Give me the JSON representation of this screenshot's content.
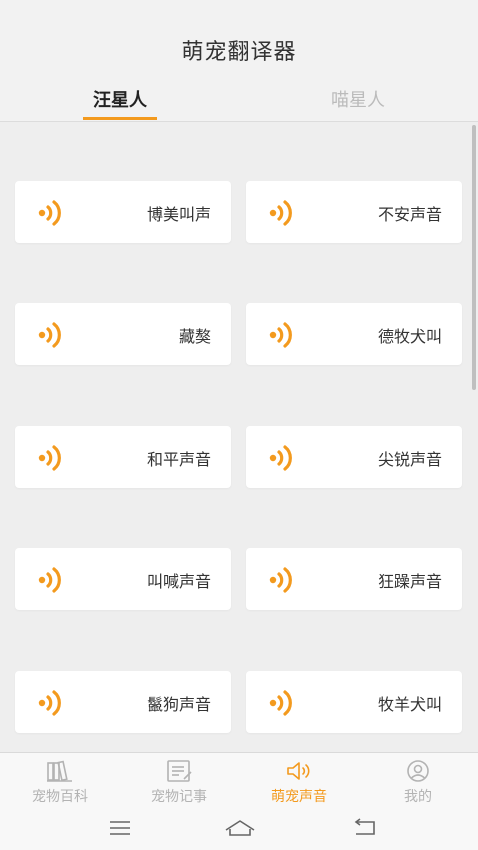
{
  "app": {
    "title": "萌宠翻译器"
  },
  "tabs": [
    {
      "label": "汪星人",
      "active": true
    },
    {
      "label": "喵星人",
      "active": false
    }
  ],
  "sounds": [
    {
      "label": "博美叫声"
    },
    {
      "label": "不安声音"
    },
    {
      "label": "藏獒"
    },
    {
      "label": "德牧犬叫"
    },
    {
      "label": "和平声音"
    },
    {
      "label": "尖锐声音"
    },
    {
      "label": "叫喊声音"
    },
    {
      "label": "狂躁声音"
    },
    {
      "label": "鬣狗声音"
    },
    {
      "label": "牧羊犬叫"
    }
  ],
  "bottom_nav": [
    {
      "label": "宠物百科",
      "icon": "books-icon",
      "active": false
    },
    {
      "label": "宠物记事",
      "icon": "notes-icon",
      "active": false
    },
    {
      "label": "萌宠声音",
      "icon": "speaker-icon",
      "active": true
    },
    {
      "label": "我的",
      "icon": "profile-icon",
      "active": false
    }
  ],
  "colors": {
    "accent": "#f39a1e",
    "background": "#eeeeee",
    "inactive": "#b3b3b3"
  }
}
